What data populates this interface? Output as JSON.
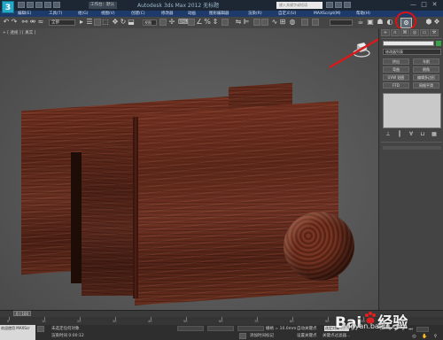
{
  "window": {
    "app_logo": "3",
    "workspace": "工作台：默认",
    "title": "Autodesk 3ds Max  2012  无标题",
    "search_placeholder": "键入关键字或短语",
    "minimize": "—",
    "restore": "□",
    "close": "✕"
  },
  "menu": {
    "items": [
      "编辑(E)",
      "工具(T)",
      "组(G)",
      "视图(V)",
      "创建(C)",
      "修改器",
      "动画",
      "图形编辑器",
      "渲染(R)",
      "自定义(U)",
      "MAXScript(M)",
      "帮助(H)"
    ]
  },
  "toolbar": {
    "selection_filter": "全部",
    "reference_coord": "视图",
    "highlight_color": "#e01010",
    "arrow_color": "#d81a1a"
  },
  "viewport": {
    "label": "+ [ 透视 ] [ 真实 ]"
  },
  "command_panel": {
    "modifier_list": "修改器列表",
    "buttons": [
      "挤出",
      "车削",
      "弯曲",
      "倒角",
      "UVW 贴图",
      "编辑多边形",
      "FFD",
      "网格平滑"
    ],
    "tabs": [
      "+",
      "∩",
      "⌘",
      "◎",
      "▭",
      "⚒"
    ]
  },
  "timeline": {
    "frame_counter": "0 / 100",
    "ticks": [
      "0",
      "10",
      "20",
      "30",
      "40",
      "50",
      "60",
      "70",
      "80",
      "90",
      "100"
    ]
  },
  "status": {
    "maxscript": "欢迎使用 MAXScr",
    "prompt_line1": "未选定任何对象",
    "prompt_line2": "渲染时间 0:00:12",
    "grid": "栅格 = 10.0mm",
    "add_time_tag": "添加时间标记",
    "auto_key": "自动关键点",
    "set_key": "设置关键点",
    "key_filter": "关键点过滤器...",
    "selected_dd": "选定对象"
  },
  "watermark": {
    "brand": "Bai",
    "brand_cn": "经验",
    "url": "jingyan.baidu.com"
  }
}
